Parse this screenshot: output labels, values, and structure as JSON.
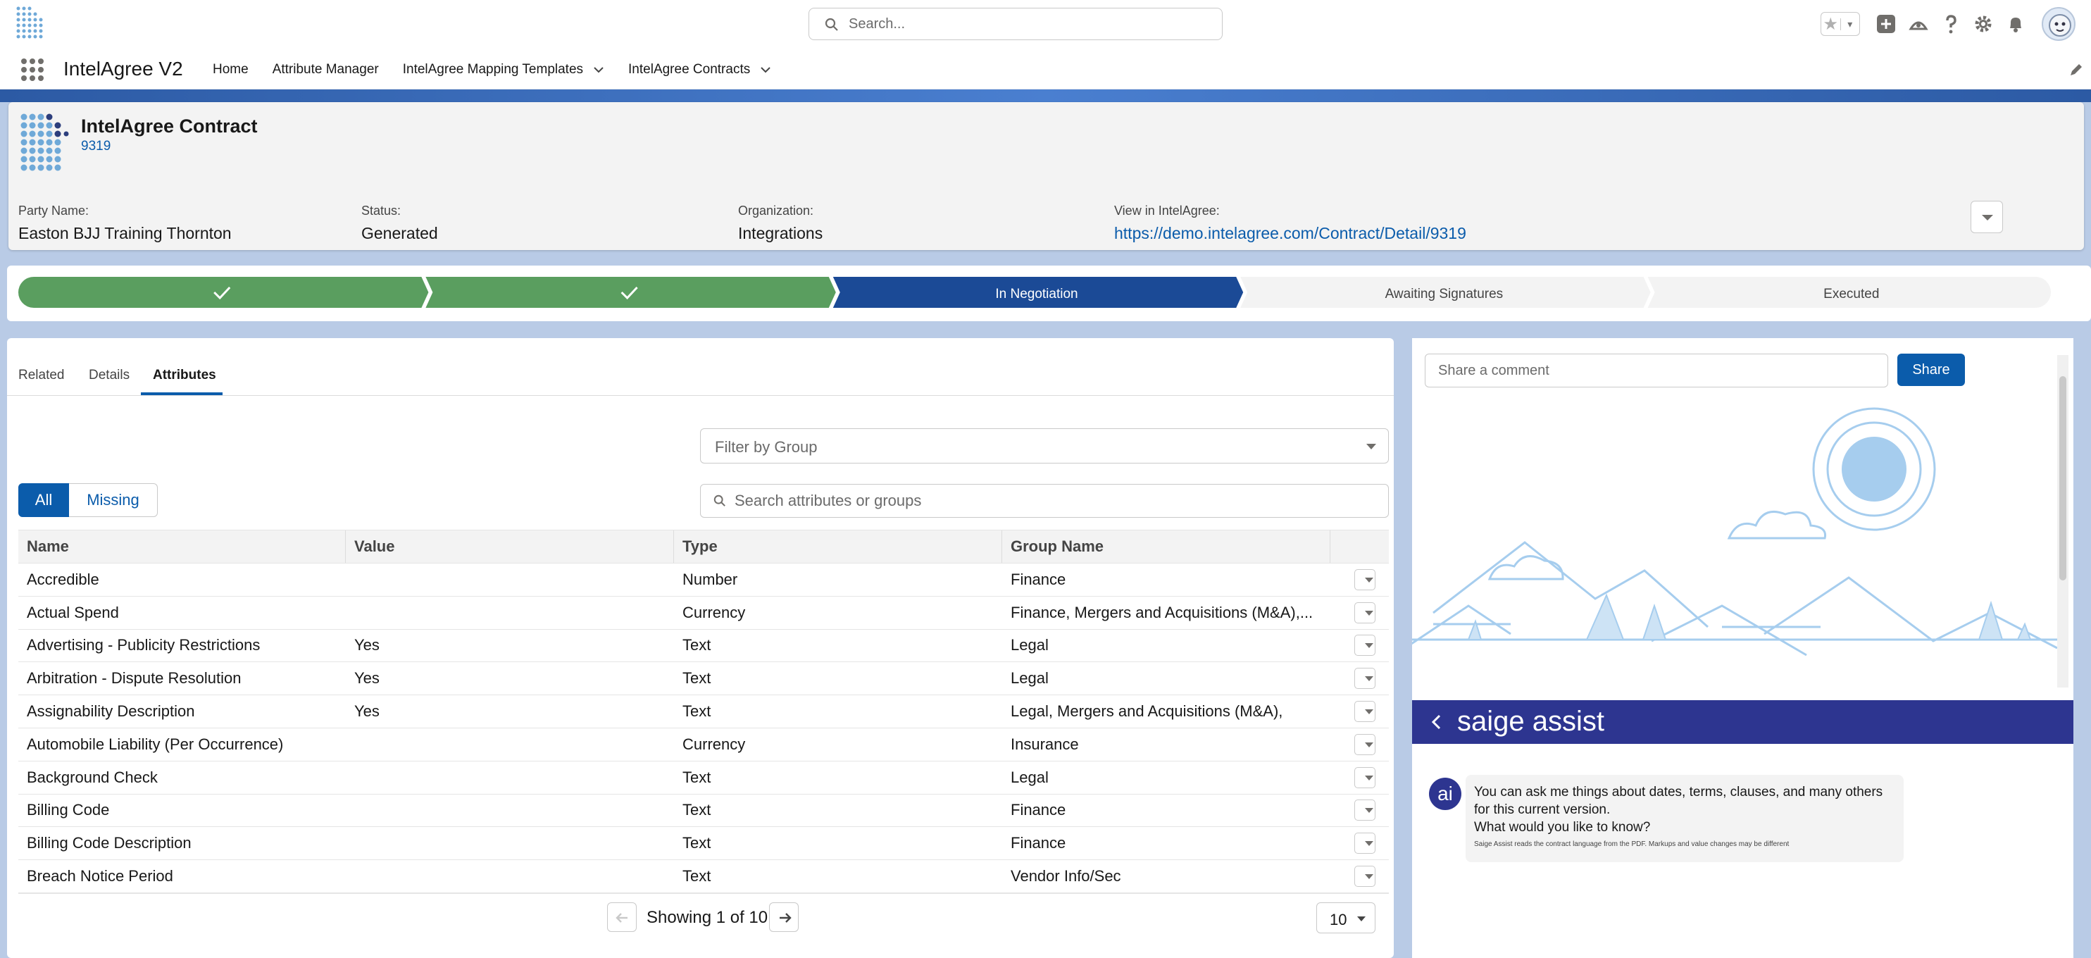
{
  "header": {
    "search_placeholder": "Search...",
    "favorite_star": "★",
    "favorite_menu": "▾",
    "icons": [
      "plus-square-icon",
      "trailhead-icon",
      "help-icon",
      "gear-icon",
      "bell-icon",
      "avatar"
    ]
  },
  "nav": {
    "app_name": "IntelAgree V2",
    "items": [
      {
        "label": "Home",
        "has_menu": false
      },
      {
        "label": "Attribute Manager",
        "has_menu": false
      },
      {
        "label": "IntelAgree Mapping Templates",
        "has_menu": true
      },
      {
        "label": "IntelAgree Contracts",
        "has_menu": true
      }
    ]
  },
  "record": {
    "object_label": "IntelAgree Contract",
    "record_id": "9319",
    "fields": [
      {
        "label": "Party Name:",
        "value": "Easton BJJ Training Thornton",
        "link": false
      },
      {
        "label": "Status:",
        "value": "Generated",
        "link": false
      },
      {
        "label": "Organization:",
        "value": "Integrations",
        "link": false
      },
      {
        "label": "View in IntelAgree:",
        "value": "https://demo.intelagree.com/Contract/Detail/9319",
        "link": true
      }
    ]
  },
  "path": {
    "stages": [
      {
        "label": "",
        "state": "complete"
      },
      {
        "label": "",
        "state": "complete"
      },
      {
        "label": "In Negotiation",
        "state": "current"
      },
      {
        "label": "Awaiting Signatures",
        "state": "incomplete"
      },
      {
        "label": "Executed",
        "state": "incomplete"
      }
    ],
    "colors": {
      "complete": "#5a9e5f",
      "current": "#1b4a96",
      "incomplete": "#f3f3f3"
    }
  },
  "tabs": {
    "items": [
      "Related",
      "Details",
      "Attributes"
    ],
    "active": "Attributes"
  },
  "attributes": {
    "filter_placeholder": "Filter by Group",
    "toggle_all": "All",
    "toggle_missing": "Missing",
    "search_placeholder": "Search attributes or groups",
    "columns": [
      "Name",
      "Value",
      "Type",
      "Group Name"
    ],
    "rows": [
      {
        "name": "Accredible",
        "value": "",
        "type": "Number",
        "group": "Finance"
      },
      {
        "name": "Actual Spend",
        "value": "",
        "type": "Currency",
        "group": "Finance, Mergers and Acquisitions (M&A),..."
      },
      {
        "name": "Advertising - Publicity Restrictions",
        "value": "Yes",
        "type": "Text",
        "group": "Legal"
      },
      {
        "name": "Arbitration - Dispute Resolution",
        "value": "Yes",
        "type": "Text",
        "group": "Legal"
      },
      {
        "name": "Assignability Description",
        "value": "Yes",
        "type": "Text",
        "group": "Legal, Mergers and Acquisitions (M&A),"
      },
      {
        "name": "Automobile Liability (Per Occurrence)",
        "value": "",
        "type": "Currency",
        "group": "Insurance"
      },
      {
        "name": "Background Check",
        "value": "",
        "type": "Text",
        "group": "Legal"
      },
      {
        "name": "Billing Code",
        "value": "",
        "type": "Text",
        "group": "Finance"
      },
      {
        "name": "Billing Code Description",
        "value": "",
        "type": "Text",
        "group": "Finance"
      },
      {
        "name": "Breach Notice Period",
        "value": "",
        "type": "Text",
        "group": "Vendor Info/Sec"
      }
    ],
    "pager_text": "Showing 1 of 10",
    "page_size": "10"
  },
  "comments": {
    "placeholder": "Share a comment",
    "share_label": "Share"
  },
  "saige": {
    "title": "saige assist",
    "avatar": "ai",
    "message_lines": [
      "You can ask me things about dates, terms, clauses, and many others",
      "for this current version.",
      "What would you like to know?"
    ],
    "disclaimer": "Saige Assist reads the contract language from the PDF. Markups and value changes may be different",
    "colors": {
      "header": "#2d3590"
    }
  }
}
